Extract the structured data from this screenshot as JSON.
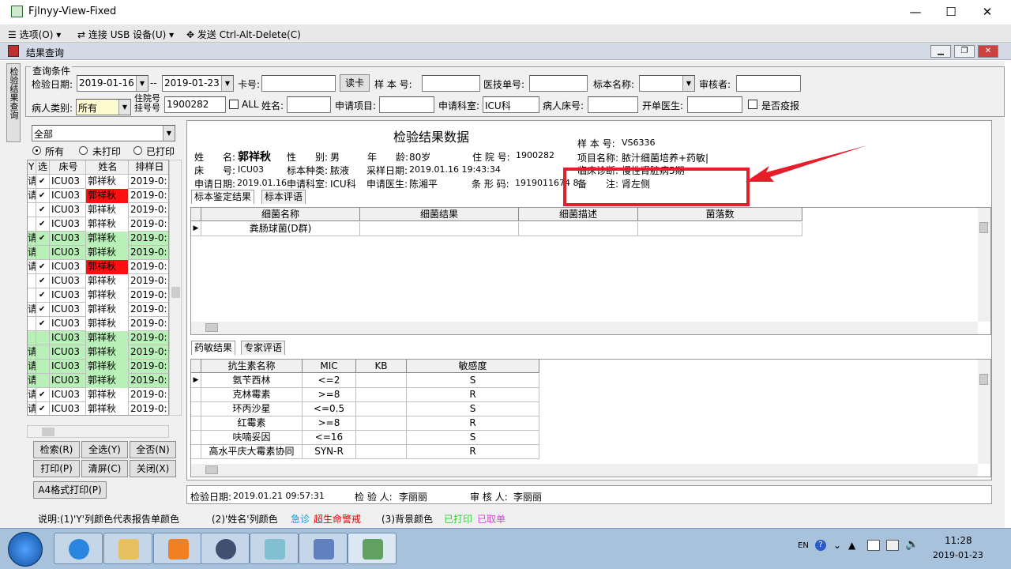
{
  "viewer": {
    "title": "Fjlnyy-View-Fixed",
    "minimize": "—",
    "maximize": "☐",
    "close": "✕",
    "menu": [
      "选项(O)",
      "连接 USB 设备(U)",
      "发送 Ctrl-Alt-Delete(C)"
    ]
  },
  "app": {
    "title": "结果查询",
    "side_tab": "检验结果查询"
  },
  "query": {
    "group": "查询条件",
    "exam_date_label": "检验日期:",
    "date_from": "2019-01-16",
    "sep": "--",
    "date_to": "2019-01-23",
    "card_label": "卡号:",
    "read_card": "读卡",
    "sample_no_label": "样 本 号:",
    "tech_no_label": "医技单号:",
    "sample_name_label": "标本名称:",
    "reviewer_label": "审核者:",
    "patient_type_label": "病人类别:",
    "patient_type": "所有",
    "inpatient_label1": "住院号",
    "inpatient_label2": "挂号号",
    "inpatient_no": "1900282",
    "all_label": "ALL",
    "name_label": "姓名:",
    "apply_item_label": "申请项目:",
    "apply_dept_label": "申请科室:",
    "apply_dept": "ICU科",
    "bed_label": "病人床号:",
    "doctor_label": "开单医生:",
    "epidemic_label": "是否疫报"
  },
  "left": {
    "filter": "全部",
    "radios": [
      "所有",
      "未打印",
      "已打印"
    ],
    "columns": [
      "Y",
      "选",
      "床号",
      "姓名",
      "排样日"
    ],
    "rows": [
      {
        "y": "请",
        "c": "✔",
        "bed": "ICU03",
        "name": "郭祥秋",
        "date": "2019-0:",
        "bg": "#ffffff",
        "nb": "#ffffff"
      },
      {
        "y": "请",
        "c": "✔",
        "bed": "ICU03",
        "name": "郭祥秋",
        "date": "2019-0:",
        "bg": "#ffffff",
        "nb": "#ff1010"
      },
      {
        "y": "",
        "c": "✔",
        "bed": "ICU03",
        "name": "郭祥秋",
        "date": "2019-0:",
        "bg": "#ffffff",
        "nb": "#ffffff"
      },
      {
        "y": "",
        "c": "✔",
        "bed": "ICU03",
        "name": "郭祥秋",
        "date": "2019-0:",
        "bg": "#ffffff",
        "nb": "#ffffff"
      },
      {
        "y": "请",
        "c": "✔",
        "bed": "ICU03",
        "name": "郭祥秋",
        "date": "2019-0:",
        "bg": "#b8f0b8",
        "nb": "#b8f0b8"
      },
      {
        "y": "请",
        "c": "",
        "bed": "ICU03",
        "name": "郭祥秋",
        "date": "2019-0:",
        "bg": "#b8f0b8",
        "nb": "#b8f0b8"
      },
      {
        "y": "请",
        "c": "✔",
        "bed": "ICU03",
        "name": "郭祥秋",
        "date": "2019-0:",
        "bg": "#ffffff",
        "nb": "#ff1010"
      },
      {
        "y": "",
        "c": "✔",
        "bed": "ICU03",
        "name": "郭祥秋",
        "date": "2019-0:",
        "bg": "#ffffff",
        "nb": "#ffffff"
      },
      {
        "y": "",
        "c": "✔",
        "bed": "ICU03",
        "name": "郭祥秋",
        "date": "2019-0:",
        "bg": "#ffffff",
        "nb": "#ffffff"
      },
      {
        "y": "请",
        "c": "✔",
        "bed": "ICU03",
        "name": "郭祥秋",
        "date": "2019-0:",
        "bg": "#ffffff",
        "nb": "#ffffff"
      },
      {
        "y": "",
        "c": "✔",
        "bed": "ICU03",
        "name": "郭祥秋",
        "date": "2019-0:",
        "bg": "#ffffff",
        "nb": "#ffffff"
      },
      {
        "y": "",
        "c": "",
        "bed": "ICU03",
        "name": "郭祥秋",
        "date": "2019-0:",
        "bg": "#b8f0b8",
        "nb": "#b8f0b8"
      },
      {
        "y": "请",
        "c": "",
        "bed": "ICU03",
        "name": "郭祥秋",
        "date": "2019-0:",
        "bg": "#b8f0b8",
        "nb": "#b8f0b8"
      },
      {
        "y": "请",
        "c": "",
        "bed": "ICU03",
        "name": "郭祥秋",
        "date": "2019-0:",
        "bg": "#b8f0b8",
        "nb": "#b8f0b8"
      },
      {
        "y": "请",
        "c": "",
        "bed": "ICU03",
        "name": "郭祥秋",
        "date": "2019-0:",
        "bg": "#b8f0b8",
        "nb": "#b8f0b8"
      },
      {
        "y": "请",
        "c": "✔",
        "bed": "ICU03",
        "name": "郭祥秋",
        "date": "2019-0:",
        "bg": "#ffffff",
        "nb": "#ffffff"
      },
      {
        "y": "请",
        "c": "✔",
        "bed": "ICU03",
        "name": "郭祥秋",
        "date": "2019-0:",
        "bg": "#ffffff",
        "nb": "#ffffff"
      }
    ],
    "buttons": [
      "检索(R)",
      "全选(Y)",
      "全否(N)",
      "打印(P)",
      "清屏(C)",
      "关闭(X)"
    ],
    "a4": "A4格式打印(P)"
  },
  "report": {
    "title": "检验结果数据",
    "name_label": "姓　　名:",
    "name": "郭祥秋",
    "sex_label": "性　　别:",
    "sex": "男",
    "age_label": "年　　龄:",
    "age": "80岁",
    "inpatient_label": "住 院 号:",
    "inpatient": "1900282",
    "sample_no_label": "样 本 号:",
    "sample_no": "VS6336",
    "item_label": "项目名称:",
    "item": "脓汁细菌培养+药敏|",
    "diag_label": "临床诊断:",
    "diag": "慢性肾脏病5期",
    "bed_label": "床　　号:",
    "bed": "ICU03",
    "sample_type_label": "标本种类:",
    "sample_type": "脓液",
    "collect_label": "采样日期:",
    "collect": "2019.01.16 19:43:34",
    "apply_date_label": "申请日期:",
    "apply_date": "2019.01.16",
    "dept_label": "申请科室:",
    "dept": "ICU科",
    "doctor_label": "申请医生:",
    "doctor": "陈湘平",
    "barcode_label": "条 形 码:",
    "barcode": "1919011674 8",
    "remark_label": "备　　注:",
    "remark": "肾左侧",
    "tabs1": [
      "标本鉴定结果",
      "标本评语"
    ],
    "bact_cols": [
      "细菌名称",
      "细菌结果",
      "细菌描述",
      "菌落数"
    ],
    "bacteria": [
      "粪肠球菌(D群)"
    ],
    "tabs2": [
      "药敏结果",
      "专家评语"
    ],
    "ab_cols": [
      "抗生素名称",
      "MIC",
      "KB",
      "敏感度"
    ],
    "antibiotics": [
      {
        "n": "氨苄西林",
        "mic": "<=2",
        "kb": "",
        "s": "S"
      },
      {
        "n": "克林霉素",
        "mic": ">=8",
        "kb": "",
        "s": "R"
      },
      {
        "n": "环丙沙星",
        "mic": "<=0.5",
        "kb": "",
        "s": "S"
      },
      {
        "n": "红霉素",
        "mic": ">=8",
        "kb": "",
        "s": "R"
      },
      {
        "n": "呋喃妥因",
        "mic": "<=16",
        "kb": "",
        "s": "S"
      },
      {
        "n": "高水平庆大霉素协同",
        "mic": "SYN-R",
        "kb": "",
        "s": "R"
      }
    ]
  },
  "status": {
    "exam_date_label": "检验日期:",
    "exam_date": "2019.01.21 09:57:31",
    "examiner_label": "检 验 人:",
    "examiner": "李丽丽",
    "reviewer_label": "审 核 人:",
    "reviewer": "李丽丽"
  },
  "note": {
    "p1": "说明:(1)'Y'列颜色代表报告单颜色",
    "p2": "(2)'姓名'列颜色",
    "urgent": "急诊",
    "critical": "超生命警戒",
    "p3": "(3)背景颜色",
    "printed": "已打印",
    "cancelled": "已取单",
    "c_urgent": "#00a0e0",
    "c_critical": "#e00000",
    "c_printed": "#30d030",
    "c_cancelled": "#e040e0"
  },
  "taskbar": {
    "lang": "EN",
    "time": "11:28",
    "date": "2019-01-23"
  }
}
